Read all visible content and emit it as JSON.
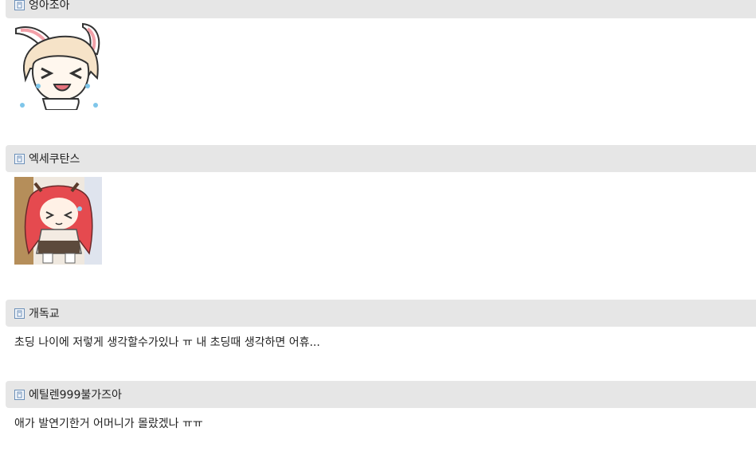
{
  "comments": [
    {
      "nickname": "엉아조아",
      "type": "emoticon",
      "emoticon": "crying-bunny-girl-emoticon"
    },
    {
      "nickname": "엑세쿠탄스",
      "type": "emoticon",
      "emoticon": "crying-red-hair-girl-emoticon"
    },
    {
      "nickname": "개독교",
      "type": "text",
      "text": "초딩 나이에 저렇게 생각할수가있나 ㅠ 내 초딩때 생각하면 어휴..."
    },
    {
      "nickname": "에틸렌999불가즈아",
      "type": "text",
      "text": "애가 발연기한거 어머니가 몰랐겠나 ㅠㅠ"
    }
  ],
  "colors": {
    "header_bg": "#e6e6e6",
    "icon_border": "#6b8fb8",
    "text": "#222222"
  }
}
